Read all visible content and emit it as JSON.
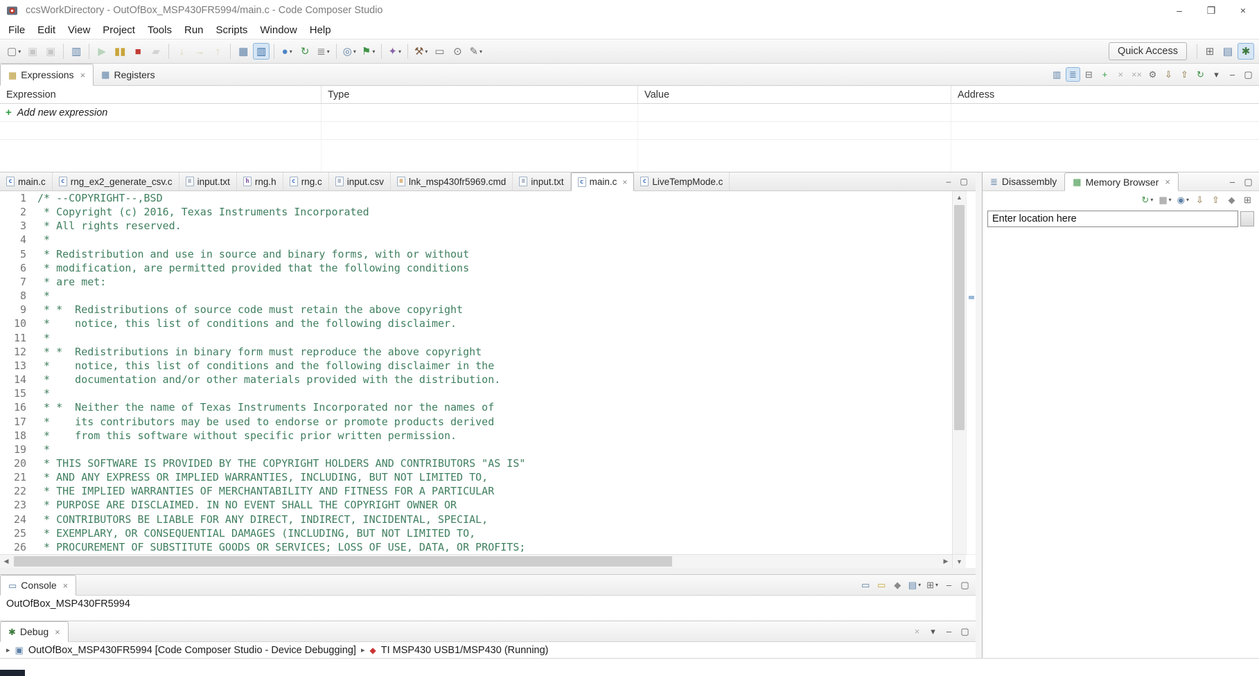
{
  "window": {
    "title": "ccsWorkDirectory - OutOfBox_MSP430FR5994/main.c - Code Composer Studio",
    "controls": [
      {
        "name": "minimize-window-button",
        "glyph": "–"
      },
      {
        "name": "maximize-window-button",
        "glyph": "❐"
      },
      {
        "name": "close-window-button",
        "glyph": "×"
      }
    ]
  },
  "menu_bar": {
    "items": [
      "File",
      "Edit",
      "View",
      "Project",
      "Tools",
      "Run",
      "Scripts",
      "Window",
      "Help"
    ]
  },
  "main_toolbar": {
    "quick_access_label": "Quick Access",
    "icons": [
      {
        "name": "new-file-icon",
        "glyph": "▢",
        "color": "#7a7a7a",
        "dropdown": true
      },
      {
        "name": "save-icon",
        "glyph": "▣",
        "color": "#7a7a7a",
        "disabled": true
      },
      {
        "name": "save-all-icon",
        "glyph": "▣",
        "color": "#7a7a7a",
        "disabled": true
      },
      {
        "sep": true
      },
      {
        "name": "debug-console-icon",
        "glyph": "▥",
        "color": "#5b7fa6"
      },
      {
        "sep": true
      },
      {
        "name": "resume-icon",
        "glyph": "▶",
        "color": "#4f9e57",
        "disabled": true
      },
      {
        "name": "suspend-icon",
        "glyph": "▮▮",
        "color": "#caa53a"
      },
      {
        "name": "terminate-icon",
        "glyph": "■",
        "color": "#c23b33"
      },
      {
        "name": "disconnect-icon",
        "glyph": "▰",
        "color": "#9a9a9a",
        "disabled": true
      },
      {
        "sep": true
      },
      {
        "name": "step-into-icon",
        "glyph": "↓",
        "color": "#b09a3e",
        "disabled": true
      },
      {
        "name": "step-over-icon",
        "glyph": "→",
        "color": "#b09a3e",
        "disabled": true
      },
      {
        "name": "step-return-icon",
        "glyph": "↑",
        "color": "#b09a3e",
        "disabled": true
      },
      {
        "sep": true
      },
      {
        "name": "view-memory-icon",
        "glyph": "▦",
        "color": "#5b7fa6"
      },
      {
        "name": "highlight-pc-icon",
        "glyph": "▥",
        "color": "#3a6ea5",
        "selected": true
      },
      {
        "sep": true
      },
      {
        "name": "breakpoints-icon",
        "glyph": "●",
        "color": "#4a84c4",
        "dropdown": true
      },
      {
        "name": "refresh-icon",
        "glyph": "↻",
        "color": "#3f9447"
      },
      {
        "name": "binary-display-icon",
        "glyph": "≣",
        "color": "#7a7a7a",
        "dropdown": true
      },
      {
        "sep": true
      },
      {
        "name": "target-config-icon",
        "glyph": "◎",
        "color": "#5b7fa6",
        "dropdown": true
      },
      {
        "name": "flash-icon",
        "glyph": "⚑",
        "color": "#3f9447",
        "dropdown": true
      },
      {
        "sep": true
      },
      {
        "name": "profile-icon",
        "glyph": "✦",
        "color": "#8a64a8",
        "dropdown": true
      },
      {
        "sep": true
      },
      {
        "name": "build-icon",
        "glyph": "⚒",
        "color": "#7c5c40",
        "dropdown": true
      },
      {
        "name": "new-terminal-icon",
        "glyph": "▭",
        "color": "#6f6f6f"
      },
      {
        "name": "search-icon",
        "glyph": "⊙",
        "color": "#6f6f6f"
      },
      {
        "name": "open-element-icon",
        "glyph": "✎",
        "color": "#6f6f6f",
        "dropdown": true
      }
    ],
    "perspective_icons": [
      {
        "name": "open-perspective-icon",
        "glyph": "⊞",
        "color": "#6f6f6f"
      },
      {
        "name": "ccs-edit-perspective-icon",
        "glyph": "▤",
        "color": "#5b7fa6"
      },
      {
        "name": "ccs-debug-perspective-icon",
        "glyph": "✱",
        "color": "#3e7a3e",
        "selected": true
      }
    ]
  },
  "expressions_view": {
    "tabs": [
      {
        "label": "Expressions",
        "icon": "expressions-icon",
        "glyph": "▦",
        "glyph_color": "#b8962e",
        "active": true,
        "closable": true
      },
      {
        "label": "Registers",
        "icon": "registers-icon",
        "glyph": "▦",
        "glyph_color": "#5b7fa6"
      }
    ],
    "toolbar_icons": [
      {
        "name": "show-type-names-icon",
        "glyph": "▥",
        "color": "#5b7fa6"
      },
      {
        "name": "show-logical-structure-icon",
        "glyph": "≣",
        "color": "#5b7fa6",
        "selected": true
      },
      {
        "name": "collapse-all-icon",
        "glyph": "⊟",
        "color": "#6f6f6f"
      },
      {
        "name": "add-expression-icon",
        "glyph": "+",
        "color": "#2f9e44"
      },
      {
        "name": "remove-expression-icon",
        "glyph": "×",
        "color": "#b0b0b0"
      },
      {
        "name": "remove-all-expressions-icon",
        "glyph": "××",
        "color": "#b0b0b0"
      },
      {
        "name": "edit-expression-icon",
        "glyph": "⚙",
        "color": "#6f6f6f"
      },
      {
        "name": "import-expressions-icon",
        "glyph": "⇩",
        "color": "#8a7340"
      },
      {
        "name": "export-expressions-icon",
        "glyph": "⇧",
        "color": "#8a7340"
      },
      {
        "name": "refresh-expressions-icon",
        "glyph": "↻",
        "color": "#3f9447"
      },
      {
        "name": "view-menu-icon",
        "glyph": "▾",
        "color": "#555555"
      },
      {
        "name": "minimize-view-icon",
        "glyph": "–",
        "color": "#555555"
      },
      {
        "name": "maximize-view-icon",
        "glyph": "▢",
        "color": "#555555"
      }
    ],
    "table": {
      "columns": [
        "Expression",
        "Type",
        "Value",
        "Address"
      ],
      "add_icon_glyph": "+",
      "add_row_label": "Add new expression"
    }
  },
  "editor": {
    "tabs": [
      {
        "label": "main.c",
        "icon": "c-file-icon",
        "glyph": "c",
        "glyph_color": "#3b6ec0"
      },
      {
        "label": "rng_ex2_generate_csv.c",
        "icon": "c-file-icon",
        "glyph": "c",
        "glyph_color": "#3b6ec0"
      },
      {
        "label": "input.txt",
        "icon": "text-file-icon",
        "glyph": "≡",
        "glyph_color": "#7a8aa0"
      },
      {
        "label": "rng.h",
        "icon": "h-file-icon",
        "glyph": "h",
        "glyph_color": "#7a4a9e"
      },
      {
        "label": "rng.c",
        "icon": "c-file-icon",
        "glyph": "c",
        "glyph_color": "#3b6ec0"
      },
      {
        "label": "input.csv",
        "icon": "text-file-icon",
        "glyph": "≡",
        "glyph_color": "#7a8aa0"
      },
      {
        "label": "lnk_msp430fr5969.cmd",
        "icon": "cmd-file-icon",
        "glyph": "≡",
        "glyph_color": "#c07820"
      },
      {
        "label": "input.txt",
        "icon": "text-file-icon",
        "glyph": "≡",
        "glyph_color": "#7a8aa0"
      },
      {
        "label": "main.c",
        "icon": "c-file-icon",
        "glyph": "c",
        "glyph_color": "#3b6ec0",
        "active": true,
        "closable": true
      },
      {
        "label": "LiveTempMode.c",
        "icon": "c-file-icon",
        "glyph": "c",
        "glyph_color": "#3b6ec0"
      }
    ],
    "tabbar_icons": [
      {
        "name": "minimize-editor-icon",
        "glyph": "–",
        "color": "#555555"
      },
      {
        "name": "maximize-editor-icon",
        "glyph": "▢",
        "color": "#555555"
      }
    ],
    "scrollbar_icons": {
      "up": "▲",
      "down": "▼",
      "left": "◀",
      "right": "▶"
    },
    "comment_color": "#3F7F5F",
    "code_lines": [
      "/* --COPYRIGHT--,BSD",
      " * Copyright (c) 2016, Texas Instruments Incorporated",
      " * All rights reserved.",
      " *",
      " * Redistribution and use in source and binary forms, with or without",
      " * modification, are permitted provided that the following conditions",
      " * are met:",
      " *",
      " * *  Redistributions of source code must retain the above copyright",
      " *    notice, this list of conditions and the following disclaimer.",
      " *",
      " * *  Redistributions in binary form must reproduce the above copyright",
      " *    notice, this list of conditions and the following disclaimer in the",
      " *    documentation and/or other materials provided with the distribution.",
      " *",
      " * *  Neither the name of Texas Instruments Incorporated nor the names of",
      " *    its contributors may be used to endorse or promote products derived",
      " *    from this software without specific prior written permission.",
      " *",
      " * THIS SOFTWARE IS PROVIDED BY THE COPYRIGHT HOLDERS AND CONTRIBUTORS \"AS IS\"",
      " * AND ANY EXPRESS OR IMPLIED WARRANTIES, INCLUDING, BUT NOT LIMITED TO,",
      " * THE IMPLIED WARRANTIES OF MERCHANTABILITY AND FITNESS FOR A PARTICULAR",
      " * PURPOSE ARE DISCLAIMED. IN NO EVENT SHALL THE COPYRIGHT OWNER OR",
      " * CONTRIBUTORS BE LIABLE FOR ANY DIRECT, INDIRECT, INCIDENTAL, SPECIAL,",
      " * EXEMPLARY, OR CONSEQUENTIAL DAMAGES (INCLUDING, BUT NOT LIMITED TO,",
      " * PROCUREMENT OF SUBSTITUTE GOODS OR SERVICES; LOSS OF USE, DATA, OR PROFITS;"
    ]
  },
  "memory_view": {
    "tabs": [
      {
        "label": "Disassembly",
        "icon": "disassembly-icon",
        "glyph": "≣",
        "glyph_color": "#5b7fa6"
      },
      {
        "label": "Memory Browser",
        "icon": "memory-browser-icon",
        "glyph": "▦",
        "glyph_color": "#3f9447",
        "active": true,
        "closable": true
      }
    ],
    "tabbar_icons": [
      {
        "name": "minimize-view-icon",
        "glyph": "–",
        "color": "#555555"
      },
      {
        "name": "maximize-view-icon",
        "glyph": "▢",
        "color": "#555555"
      }
    ],
    "toolbar_icons": [
      {
        "name": "refresh-memory-icon",
        "glyph": "↻",
        "color": "#3f9447",
        "dropdown": true
      },
      {
        "name": "memory-config-icon",
        "glyph": "▦",
        "color": "#8a8a8a",
        "dropdown": true
      },
      {
        "name": "display-format-icon",
        "glyph": "◉",
        "color": "#5b7fa6",
        "dropdown": true
      },
      {
        "name": "save-memory-icon",
        "glyph": "⇩",
        "color": "#8a7340"
      },
      {
        "name": "load-memory-icon",
        "glyph": "⇧",
        "color": "#8a7340"
      },
      {
        "name": "pin-view-icon",
        "glyph": "◆",
        "color": "#8a8a8a"
      },
      {
        "name": "new-memory-tab-icon",
        "glyph": "⊞",
        "color": "#6f6f6f"
      }
    ],
    "location_input": {
      "value": "Enter location here"
    }
  },
  "console_view": {
    "tab": {
      "label": "Console",
      "icon": "console-icon",
      "glyph": "▭",
      "glyph_color": "#5b7fa6",
      "active": true,
      "closable": true
    },
    "toolbar_icons": [
      {
        "name": "show-console-output-icon",
        "glyph": "▭",
        "color": "#5b7fa6"
      },
      {
        "name": "scroll-lock-icon",
        "glyph": "▭",
        "color": "#caa53a"
      },
      {
        "name": "pin-console-icon",
        "glyph": "◆",
        "color": "#8a8a8a"
      },
      {
        "name": "display-selected-console-icon",
        "glyph": "▤",
        "color": "#5b7fa6",
        "dropdown": true
      },
      {
        "name": "open-console-icon",
        "glyph": "⊞",
        "color": "#6f6f6f",
        "dropdown": true
      },
      {
        "name": "minimize-view-icon",
        "glyph": "–",
        "color": "#555555"
      },
      {
        "name": "maximize-view-icon",
        "glyph": "▢",
        "color": "#555555"
      }
    ],
    "content": "OutOfBox_MSP430FR5994"
  },
  "debug_view": {
    "tab": {
      "label": "Debug",
      "icon": "debug-icon",
      "glyph": "✱",
      "glyph_color": "#3e7a3e",
      "active": true,
      "closable": true
    },
    "toolbar_icons": [
      {
        "name": "remove-terminated-icon",
        "glyph": "×",
        "color": "#b0b0b0"
      },
      {
        "name": "view-menu-icon",
        "glyph": "▾",
        "color": "#555555"
      },
      {
        "name": "minimize-view-icon",
        "glyph": "–",
        "color": "#555555"
      },
      {
        "name": "maximize-view-icon",
        "glyph": "▢",
        "color": "#555555"
      }
    ],
    "twisty_glyph": "▸",
    "tree": [
      {
        "label": "OutOfBox_MSP430FR5994 [Code Composer Studio - Device Debugging]",
        "icon": "debug-session-icon",
        "glyph": "▣"
      },
      {
        "label": "TI MSP430 USB1/MSP430 (Running)",
        "icon": "ti-target-icon",
        "glyph": "◆"
      }
    ]
  }
}
